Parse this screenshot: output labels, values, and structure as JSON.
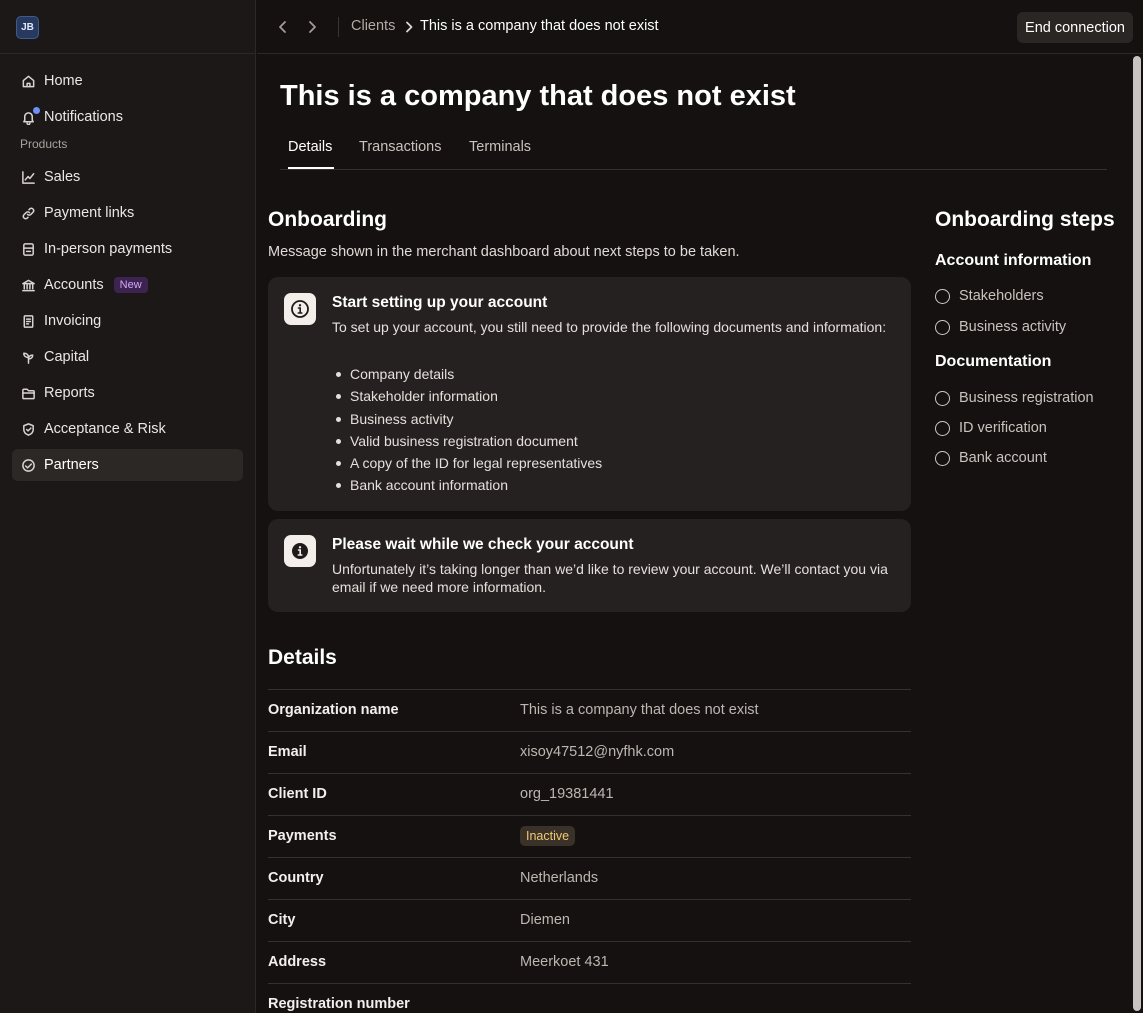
{
  "user": {
    "initials": "JB"
  },
  "sidebar": {
    "section_label": "Products",
    "items": [
      {
        "label": "Home",
        "icon": "home-icon"
      },
      {
        "label": "Notifications",
        "icon": "bell-icon"
      },
      {
        "label": "Sales",
        "icon": "chart-line-icon"
      },
      {
        "label": "Payment links",
        "icon": "link-icon"
      },
      {
        "label": "In-person payments",
        "icon": "terminal-icon"
      },
      {
        "label": "Accounts",
        "icon": "bank-icon",
        "badge": "New"
      },
      {
        "label": "Invoicing",
        "icon": "invoice-icon"
      },
      {
        "label": "Capital",
        "icon": "sprout-icon"
      },
      {
        "label": "Reports",
        "icon": "folder-icon"
      },
      {
        "label": "Acceptance & Risk",
        "icon": "shield-icon"
      },
      {
        "label": "Partners",
        "icon": "handshake-icon",
        "active": true
      }
    ]
  },
  "topbar": {
    "breadcrumb_parent": "Clients",
    "breadcrumb_current": "This is a company that does not exist",
    "end_connection_label": "End connection"
  },
  "page": {
    "title": "This is a company that does not exist",
    "tabs": [
      "Details",
      "Transactions",
      "Terminals"
    ],
    "active_tab": "Details"
  },
  "onboarding": {
    "title": "Onboarding",
    "subtitle": "Message shown in the merchant dashboard about next steps to be taken.",
    "card1": {
      "title": "Start setting up your account",
      "text": "To set up your account, you still need to provide the following documents and information:",
      "items": [
        "Company details",
        "Stakeholder information",
        "Business activity",
        "Valid business registration document",
        "A copy of the ID for legal representatives",
        "Bank account information"
      ]
    },
    "card2": {
      "title": "Please wait while we check your account",
      "text": "Unfortunately it’s taking longer than we’d like to review your account. We’ll contact you via email if we need more information."
    }
  },
  "details": {
    "title": "Details",
    "rows": [
      {
        "label": "Organization name",
        "value": "This is a company that does not exist"
      },
      {
        "label": "Email",
        "value": "xisoy47512@nyfhk.com"
      },
      {
        "label": "Client ID",
        "value": "org_19381441"
      },
      {
        "label": "Payments",
        "value": "Inactive"
      },
      {
        "label": "Country",
        "value": "Netherlands"
      },
      {
        "label": "City",
        "value": "Diemen"
      },
      {
        "label": "Address",
        "value": "Meerkoet 431"
      },
      {
        "label": "Registration number",
        "value": ""
      }
    ],
    "status_color": "#f0c974"
  },
  "steps": {
    "title": "Onboarding steps",
    "groups": [
      {
        "title": "Account information",
        "items": [
          "Stakeholders",
          "Business activity"
        ]
      },
      {
        "title": "Documentation",
        "items": [
          "Business registration",
          "ID verification",
          "Bank account"
        ]
      }
    ]
  },
  "colors": {
    "accent": "#6f8ff5",
    "background": "#141110",
    "sidebar": "#1b1817",
    "card": "#252120"
  }
}
